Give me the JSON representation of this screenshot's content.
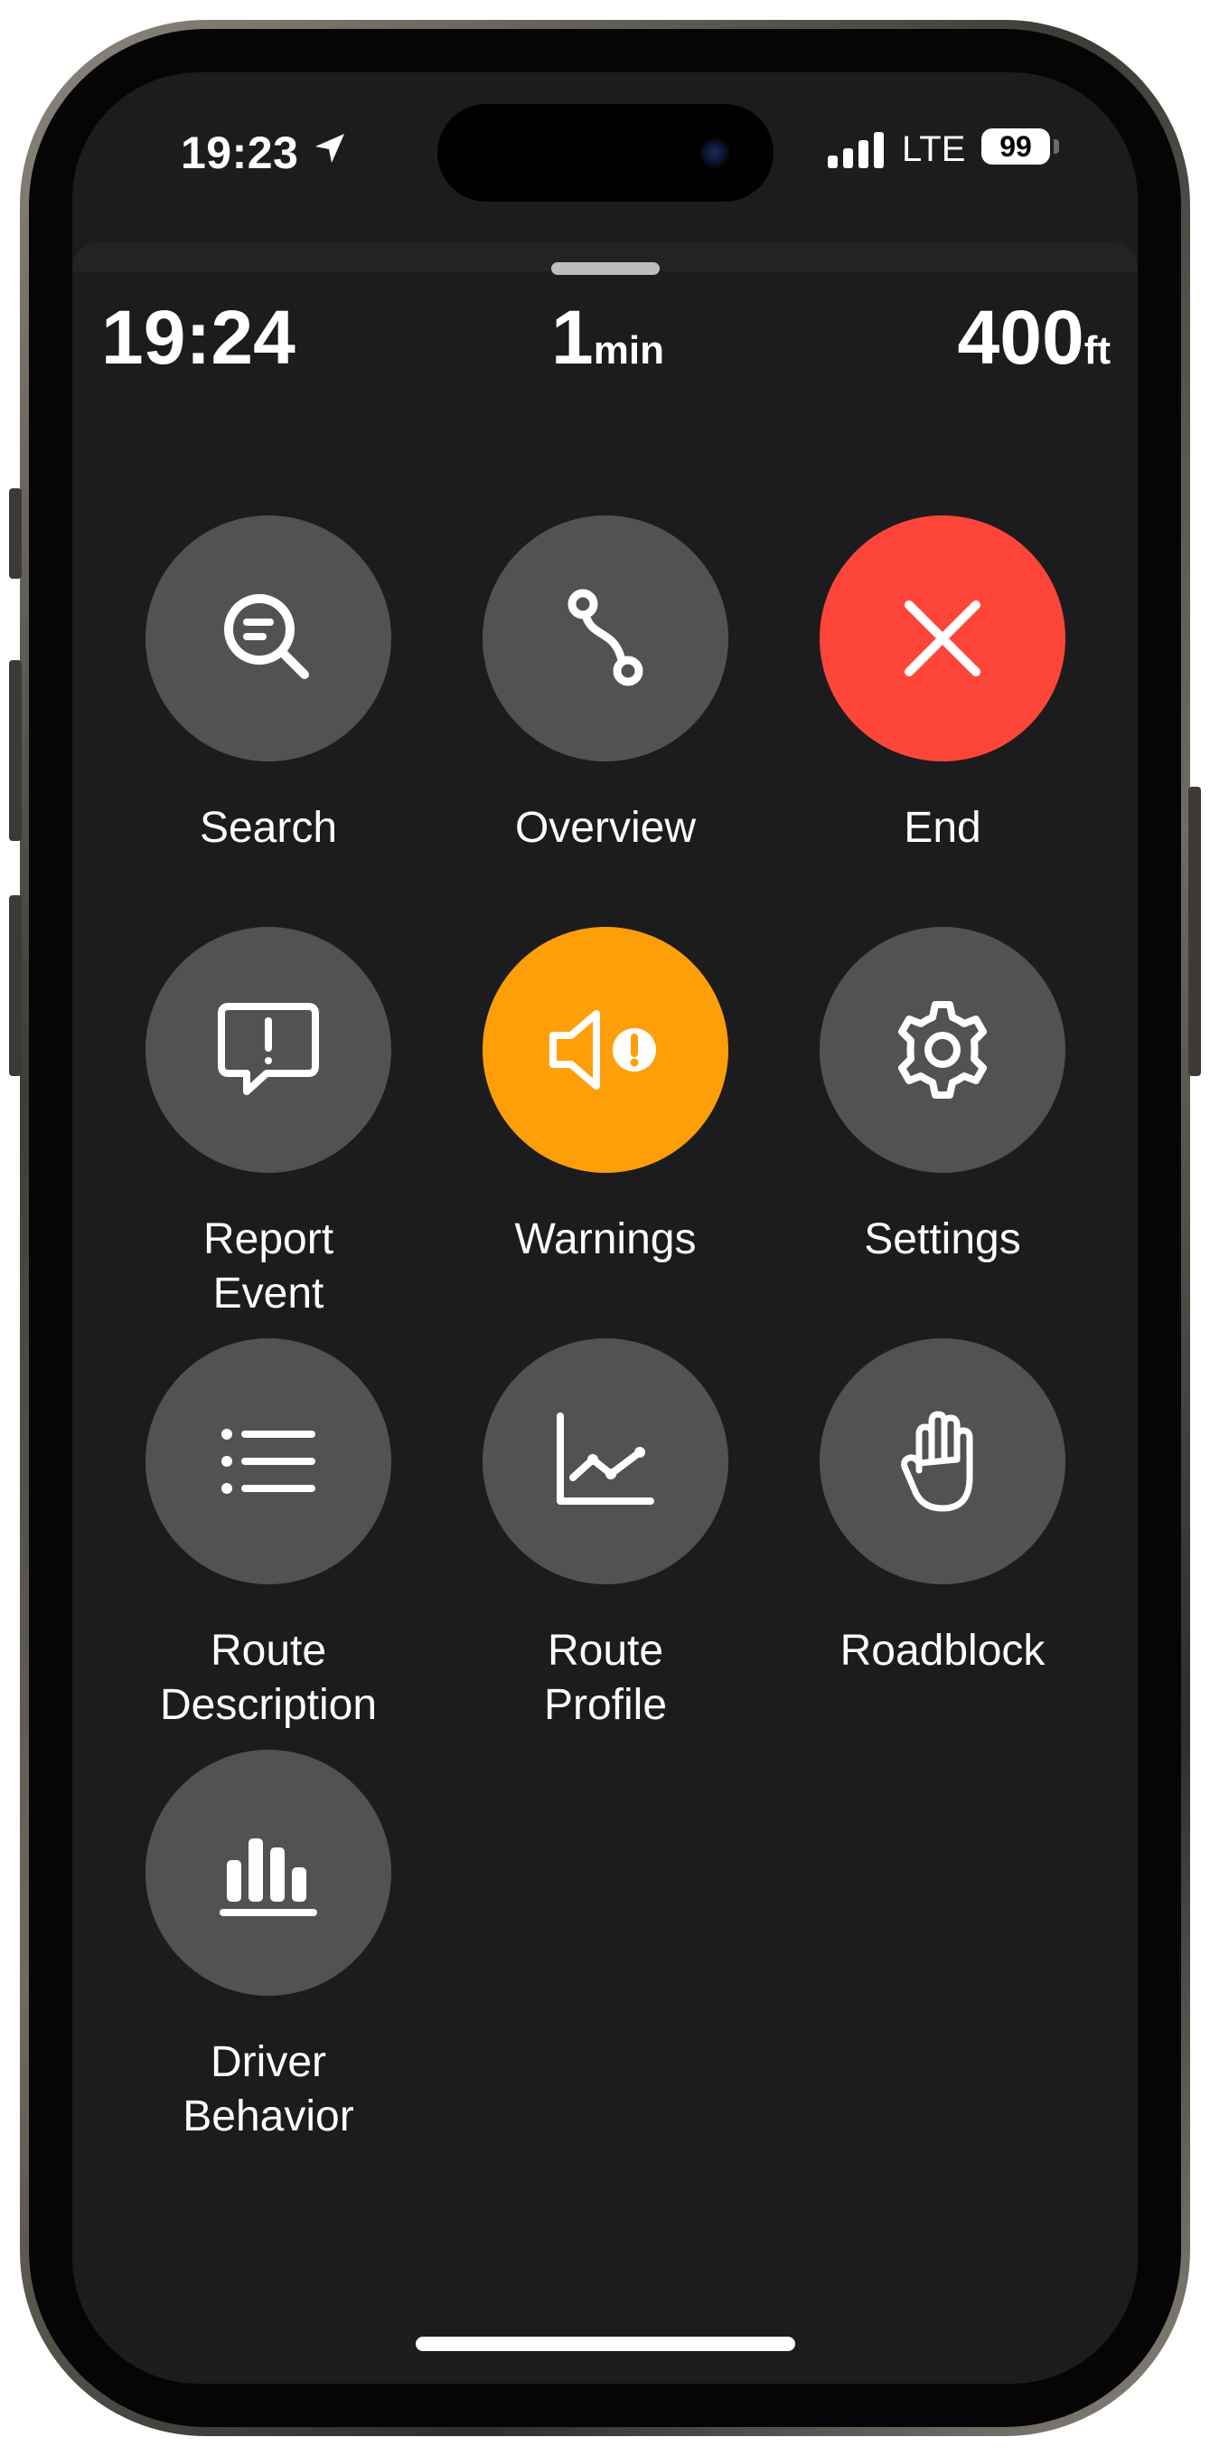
{
  "status_bar": {
    "time": "19:23",
    "network": "LTE",
    "battery": "99"
  },
  "trip": {
    "arrival_time": "19:24",
    "duration_value": "1",
    "duration_unit": "min",
    "distance_value": "400",
    "distance_unit": "ft"
  },
  "menu": {
    "search": "Search",
    "overview": "Overview",
    "end": "End",
    "report_line1": "Report",
    "report_line2": "Event",
    "warnings": "Warnings",
    "settings": "Settings",
    "route_desc_line1": "Route",
    "route_desc_line2": "Description",
    "route_profile_line1": "Route",
    "route_profile_line2": "Profile",
    "roadblock": "Roadblock",
    "driver_line1": "Driver",
    "driver_line2": "Behavior"
  },
  "colors": {
    "button_gray": "#525252",
    "end_red": "#fe453a",
    "warnings_orange": "#fe9f0a",
    "background": "#1c1c1e"
  },
  "icons": {
    "search": "search-list-icon",
    "overview": "route-path-icon",
    "end": "close-icon",
    "report": "exclamation-bubble-icon",
    "warnings": "speaker-alert-icon",
    "settings": "gear-icon",
    "route_description": "list-icon",
    "route_profile": "line-chart-icon",
    "roadblock": "hand-raised-icon",
    "driver_behavior": "bar-chart-icon"
  }
}
